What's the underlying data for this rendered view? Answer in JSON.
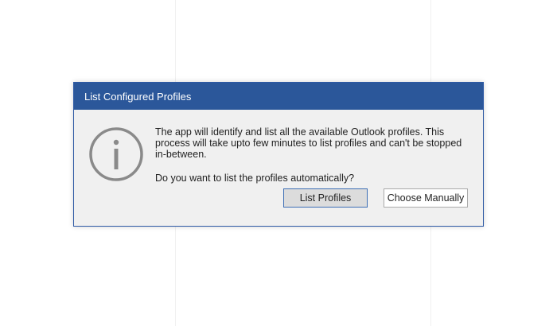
{
  "dialog": {
    "title": "List Configured Profiles",
    "icon": "info-circle-icon",
    "message": "The app will identify and list all the available Outlook profiles. This process will take upto few minutes to list profiles and can't be stopped in-between.",
    "question": "Do you want to list the profiles automatically?",
    "buttons": {
      "list_profiles": "List Profiles",
      "choose_manually": "Choose Manually"
    }
  },
  "colors": {
    "titlebar": "#2b579a",
    "dialog_bg": "#f0f0f0",
    "icon": "#8a8a8a",
    "primary_button_border": "#3e6fb5"
  }
}
